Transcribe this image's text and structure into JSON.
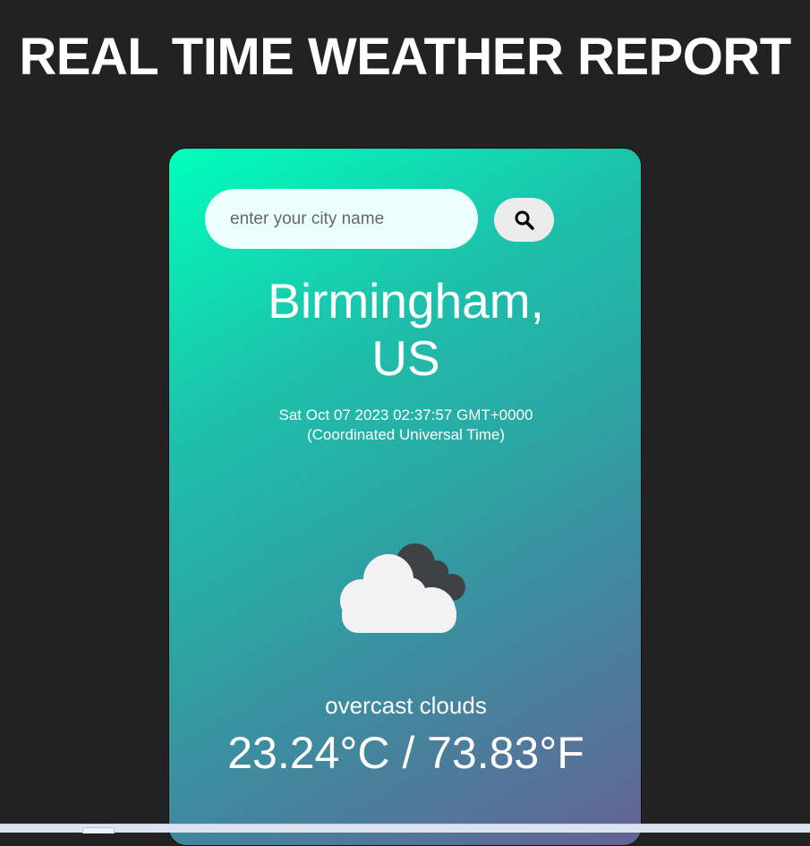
{
  "page": {
    "title": "REAL TIME WEATHER REPORT"
  },
  "search": {
    "placeholder": "enter your city name",
    "button_icon": "search-icon"
  },
  "weather": {
    "city_line1": "Birmingham,",
    "city_line2": "US",
    "datetime_line1": "Sat Oct 07 2023 02:37:57 GMT+0000",
    "datetime_line2": "(Coordinated Universal Time)",
    "icon": "overcast-clouds-icon",
    "description": "overcast clouds",
    "temperature": "23.24°C / 73.83°F"
  },
  "colors": {
    "background": "#222222",
    "card_gradient_start": "#00ffbc",
    "card_gradient_end": "#646290",
    "search_field": "#ebfffd",
    "search_button": "#ececec",
    "text": "#ffffff"
  }
}
